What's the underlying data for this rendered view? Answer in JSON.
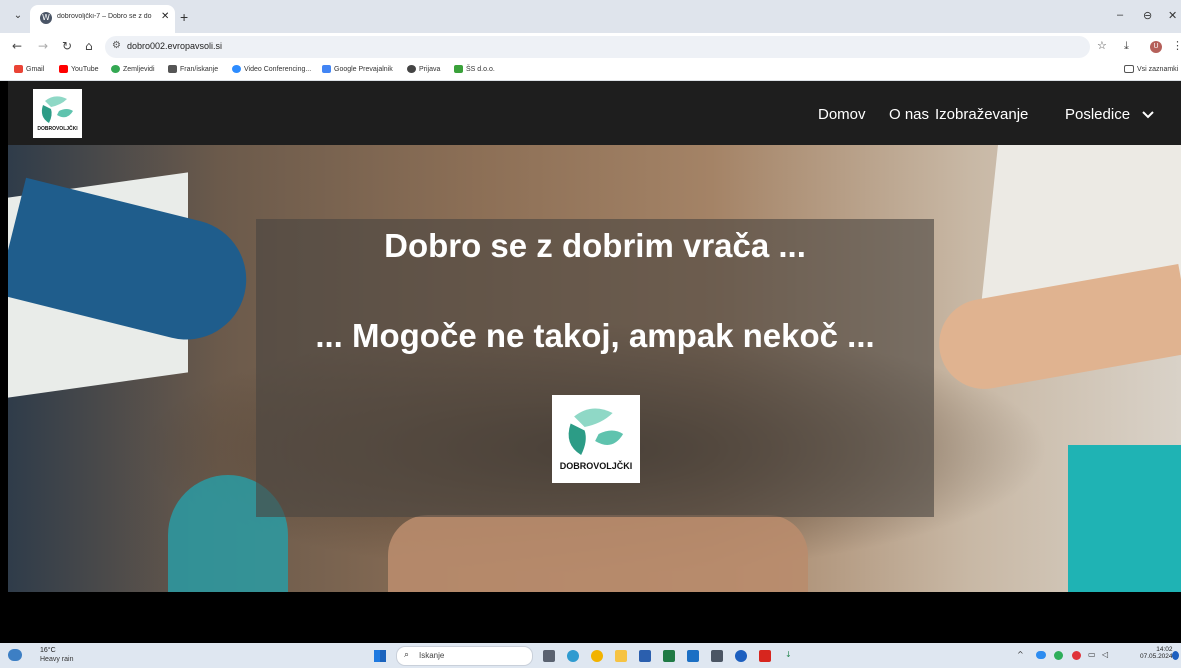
{
  "browser": {
    "tab": {
      "title": "dobrovoljčki-7 – Dobro se z do"
    },
    "new_tab": "+",
    "window_controls": {
      "minimize": "–",
      "restore": "⊖",
      "close": "✕"
    },
    "url": "dobro002.evropavsoli.si",
    "bookmarks": [
      {
        "label": "Gmail",
        "icon": "gmail-icon",
        "color": "#ea4335"
      },
      {
        "label": "YouTube",
        "icon": "youtube-icon",
        "color": "#ff0000"
      },
      {
        "label": "Zemljevidi",
        "icon": "maps-icon",
        "color": "#34a853"
      },
      {
        "label": "Fran/iskanje",
        "icon": "fran-icon",
        "color": "#555555"
      },
      {
        "label": "Video Conferencing...",
        "icon": "zoom-icon",
        "color": "#2d8cff"
      },
      {
        "label": "Google Prevajalnik",
        "icon": "translate-icon",
        "color": "#4285f4"
      },
      {
        "label": "Prijava",
        "icon": "login-icon",
        "color": "#444444"
      },
      {
        "label": "ŠS d.o.o.",
        "icon": "company-icon",
        "color": "#3aa13a"
      }
    ],
    "all_bookmarks": "Vsi zaznamki",
    "profile_initial": "U"
  },
  "site": {
    "logo_text": "DOBROVOLJČKI",
    "nav": [
      "Domov",
      "O nas",
      "Izobraževanje",
      "Posledice"
    ],
    "nav_dropdown_icon": "chevron-down-icon"
  },
  "hero": {
    "line1": "Dobro se z dobrim vrača ...",
    "line2": "... Mogoče ne takoj, ampak nekoč ...",
    "logo_text": "DOBROVOLJČKI"
  },
  "taskbar": {
    "weather_temp": "16°C",
    "weather_desc": "Heavy rain",
    "search_placeholder": "Iskanje",
    "time": "14:02",
    "date": "07.05.2024"
  },
  "colors": {
    "header_bg": "#1e1e1e",
    "logo_teal": "#3fb6a0",
    "tab_bar": "#dfe4ec"
  }
}
